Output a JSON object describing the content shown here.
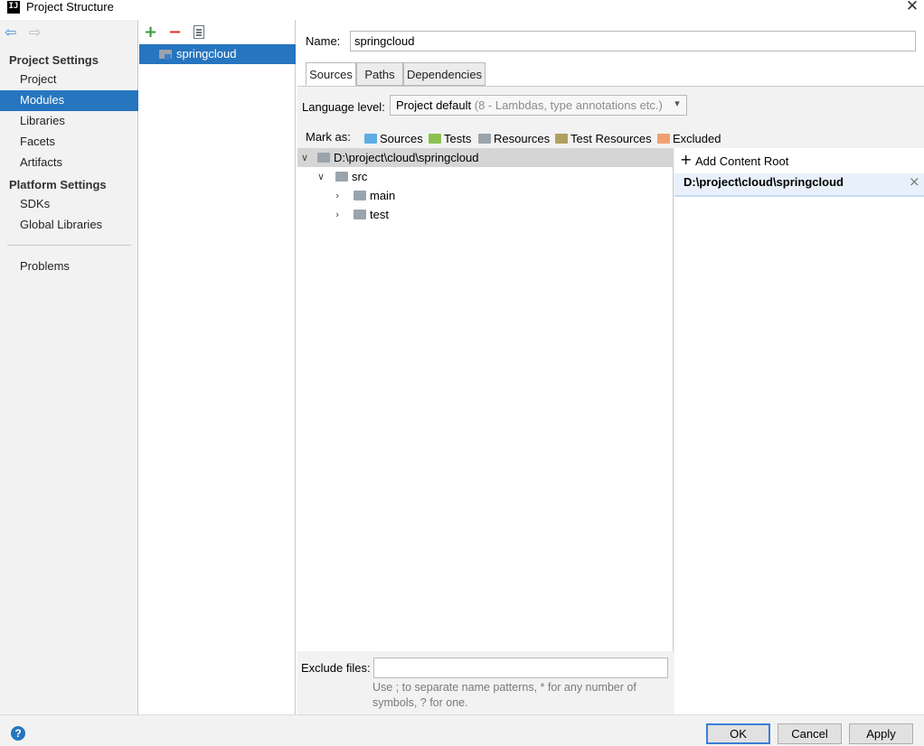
{
  "window": {
    "title": "Project Structure",
    "app_icon_label": "IJ"
  },
  "nav": {
    "back_icon": "arrow-left-icon",
    "forward_icon": "arrow-right-icon",
    "project_settings_title": "Project Settings",
    "project_settings_items": [
      "Project",
      "Modules",
      "Libraries",
      "Facets",
      "Artifacts"
    ],
    "platform_settings_title": "Platform Settings",
    "platform_settings_items": [
      "SDKs",
      "Global Libraries"
    ],
    "problems": "Problems",
    "selected": "Modules"
  },
  "modules": {
    "toolbar": {
      "add": "+",
      "remove": "−",
      "copy_icon": "copy-icon"
    },
    "items": [
      "springcloud"
    ]
  },
  "module": {
    "name_label": "Name:",
    "name_value": "springcloud",
    "tabs": [
      "Sources",
      "Paths",
      "Dependencies"
    ],
    "active_tab": "Sources",
    "language_level_label": "Language level:",
    "language_level_value": "Project default",
    "language_level_hint": "(8 - Lambdas, type annotations etc.)",
    "mark_as_label": "Mark as:",
    "mark_as": [
      {
        "label": "Sources",
        "color": "#5dade2"
      },
      {
        "label": "Tests",
        "color": "#8cc152"
      },
      {
        "label": "Resources",
        "color": "#9aa4ad"
      },
      {
        "label": "Test Resources",
        "color": "#b0a060"
      },
      {
        "label": "Excluded",
        "color": "#f0a070"
      }
    ],
    "tree": {
      "root": "D:\\project\\cloud\\springcloud",
      "src": "src",
      "children": [
        "main",
        "test"
      ]
    },
    "content_root": {
      "add_label": "Add Content Root",
      "path": "D:\\project\\cloud\\springcloud",
      "remove": "×"
    },
    "exclude_label": "Exclude files:",
    "exclude_value": "",
    "exclude_hint_line1": "Use ; to separate name patterns, * for any number of",
    "exclude_hint_line2": "symbols, ? for one."
  },
  "footer": {
    "help": "?",
    "ok": "OK",
    "cancel": "Cancel",
    "apply": "Apply"
  }
}
